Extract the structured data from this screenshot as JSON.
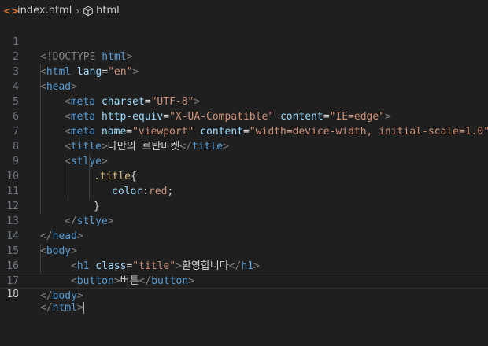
{
  "breadcrumb": {
    "file_icon": "<>",
    "file_name": "index.html",
    "separator": "›",
    "symbol_icon": "cube-icon",
    "symbol_name": "html"
  },
  "line_numbers": [
    "1",
    "2",
    "3",
    "4",
    "5",
    "6",
    "7",
    "8",
    "9",
    "10",
    "11",
    "12",
    "13",
    "14",
    "15",
    "16",
    "17",
    "18"
  ],
  "active_line": 18,
  "code": {
    "l1": {
      "open": "<!DOCTYPE",
      "kw": " html",
      "close": ">"
    },
    "l2": {
      "open": "<",
      "tag": "html",
      "attr": " lang",
      "eq": "=",
      "val": "\"en\"",
      "close": ">"
    },
    "l3": {
      "open": "<",
      "tag": "head",
      "close": ">"
    },
    "l4": {
      "open": "<",
      "tag": "meta",
      "attr": " charset",
      "eq": "=",
      "val": "\"UTF-8\"",
      "close": ">"
    },
    "l5": {
      "open": "<",
      "tag": "meta",
      "attr1": " http-equiv",
      "eq1": "=",
      "val1": "\"X-UA-Compatible\"",
      "attr2": " content",
      "eq2": "=",
      "val2": "\"IE=edge\"",
      "close": ">"
    },
    "l6": {
      "open": "<",
      "tag": "meta",
      "attr1": " name",
      "eq1": "=",
      "val1": "\"viewport\"",
      "attr2": " content",
      "eq2": "=",
      "val2": "\"width=device-width, initial-scale=1.0\"",
      "close": ">"
    },
    "l7": {
      "open": "<",
      "tag": "title",
      "close": ">",
      "text": "나만의 르탄마켓",
      "open2": "</",
      "tag2": "title",
      "close2": ">"
    },
    "l8": {
      "open": "<",
      "tag": "stlye",
      "close": ">"
    },
    "l9": {
      "selector": ".title",
      "brace": "{"
    },
    "l10": {
      "prop": "color",
      "colon": ":",
      "val": "red",
      "semi": ";"
    },
    "l11": {
      "brace": "}"
    },
    "l12": {
      "open": "</",
      "tag": "stlye",
      "close": ">"
    },
    "l13": {
      "open": "</",
      "tag": "head",
      "close": ">"
    },
    "l14": {
      "open": "<",
      "tag": "body",
      "close": ">"
    },
    "l15": {
      "open": "<",
      "tag": "h1",
      "attr": " class",
      "eq": "=",
      "val": "\"title\"",
      "close": ">",
      "text": "환영합니다",
      "open2": "</",
      "tag2": "h1",
      "close2": ">"
    },
    "l16": {
      "open": "<",
      "tag": "button",
      "close": ">",
      "text": "버튼",
      "open2": "</",
      "tag2": "button",
      "close2": ">"
    },
    "l17": {
      "open": "</",
      "tag": "body",
      "close": ">"
    },
    "l18": {
      "open": "</",
      "tag": "html",
      "close": ">"
    }
  }
}
